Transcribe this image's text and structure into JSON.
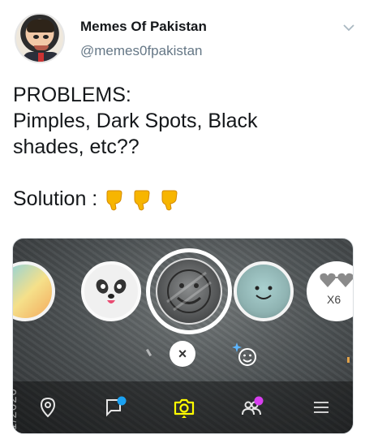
{
  "tweet": {
    "account_name": "Memes Of Pakistan",
    "account_handle": "@memes0fpakistan",
    "text_lines": [
      "PROBLEMS:",
      "Pimples, Dark Spots, Black",
      "shades, etc??"
    ],
    "solution_label": "Solution :",
    "emoji": [
      "backhand-index-pointing-down",
      "backhand-index-pointing-down",
      "backhand-index-pointing-down"
    ]
  },
  "media": {
    "lens_carousel": [
      {
        "name": "gradient-lens"
      },
      {
        "name": "panda-lens"
      },
      {
        "name": "selected-lens"
      },
      {
        "name": "smiley-lens"
      },
      {
        "name": "hearts-lens",
        "label": "X6"
      }
    ],
    "close_label": "×",
    "year_stamp": "1/2020",
    "nav_items": [
      "map-icon",
      "chat-icon",
      "camera-icon",
      "friends-icon",
      "menu-icon"
    ]
  },
  "colors": {
    "text": "#14171a",
    "handle": "#657786",
    "emoji_yellow": "#f7b500",
    "camera_yellow": "#fffc00",
    "chat_badge": "#1aa1f2",
    "friends_badge": "#d83ff0"
  }
}
